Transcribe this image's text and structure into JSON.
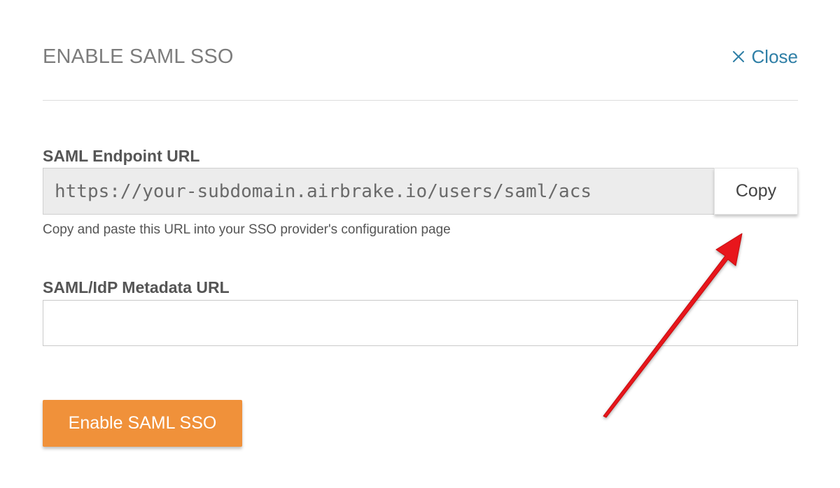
{
  "modal": {
    "title": "ENABLE SAML SSO",
    "close_label": "Close",
    "close_icon": "close-icon"
  },
  "endpoint": {
    "label": "SAML Endpoint URL",
    "value": "https://your-subdomain.airbrake.io/users/saml/acs",
    "copy_label": "Copy",
    "help_text": "Copy and paste this URL into your SSO provider's configuration page"
  },
  "metadata": {
    "label": "SAML/IdP Metadata URL",
    "value": "",
    "placeholder": ""
  },
  "submit": {
    "label": "Enable SAML SSO"
  },
  "annotation": {
    "icon": "red-arrow-icon",
    "color": "#e8141a"
  },
  "colors": {
    "accent": "#f0913a",
    "link": "#2f7fa6"
  }
}
